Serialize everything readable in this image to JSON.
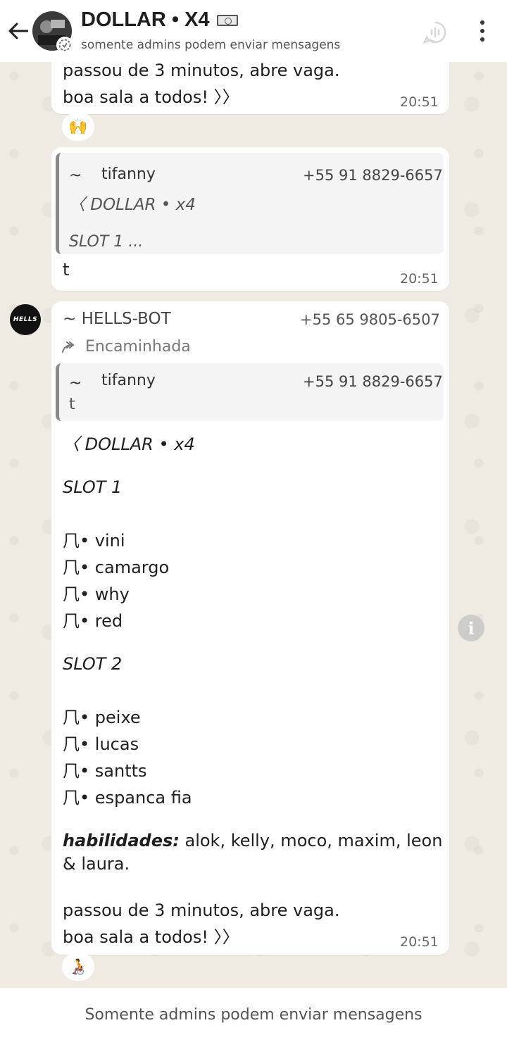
{
  "header": {
    "title": "DOLLAR • X4",
    "title_icon": "money-bill-icon",
    "subtitle": "somente admins podem enviar mensagens"
  },
  "top_message": {
    "line1": "passou de 3 minutos, abre vaga.",
    "line2": "boa sala a todos! 〉〉",
    "time": "20:51",
    "reaction": "🙌"
  },
  "reply_message": {
    "quote": {
      "name_prefix": "~",
      "name": "tifanny",
      "phone": "+55 91 8829-6657",
      "line1": "〈  DOLLAR • x4",
      "line2": "SLOT 1 ..."
    },
    "text": "t",
    "time": "20:51"
  },
  "bot_message": {
    "avatar_text": "HELLS",
    "sender": "~ HELLS-BOT",
    "phone": "+55 65 9805-6507",
    "forwarded_label": "Encaminhada",
    "quote": {
      "name_prefix": "~",
      "name": "tifanny",
      "phone": "+55 91 8829-6657",
      "text": "t"
    },
    "heading": "〈  DOLLAR • x4",
    "slot1_title": "SLOT 1",
    "slot1": [
      "vini",
      "camargo",
      "why",
      "red"
    ],
    "slot2_title": "SLOT 2",
    "slot2": [
      "peixe",
      "lucas",
      "santts",
      "espanca fia"
    ],
    "bullet": "⺇•",
    "skills_label": "habilidades:",
    "skills_line1": " alok, kelly, moco, maxim, leon",
    "skills_line2": "& laura.",
    "closing1": "passou de 3 minutos, abre vaga.",
    "closing2": "boa sala a todos! 〉〉",
    "time": "20:51",
    "reaction": "🧑‍🦽"
  },
  "footer": {
    "notice": "Somente admins podem enviar mensagens"
  },
  "colors": {
    "background": "#efeae2",
    "bubble": "#ffffff",
    "quote_bar": "#8a8a8a"
  }
}
